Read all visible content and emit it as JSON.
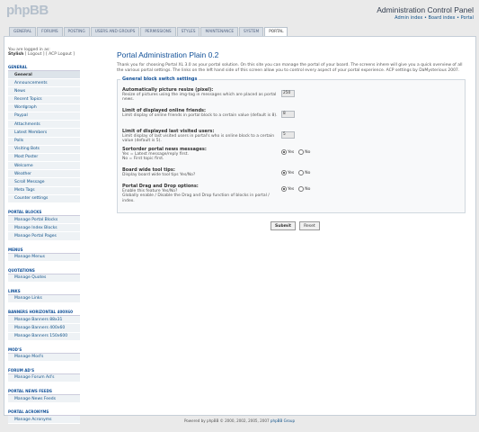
{
  "header": {
    "logo_text": "phpBB",
    "panel_title": "Administration Control Panel",
    "links": [
      "Admin index",
      "Board index",
      "Portal"
    ],
    "link_separator": "•"
  },
  "tabs": [
    "GENERAL",
    "FORUMS",
    "POSTING",
    "USERS AND GROUPS",
    "PERMISSIONS",
    "STYLES",
    "MAINTENANCE",
    "SYSTEM",
    "PORTAL"
  ],
  "active_tab": "PORTAL",
  "login": {
    "text": "You are logged in as:",
    "user": "Stylish",
    "logout": "[ Logout ]",
    "acp_logout": "[ ACP Logout ]"
  },
  "sidebar": [
    {
      "head": "General",
      "items": [
        "General",
        "Announcements",
        "News",
        "Recent Topics",
        "Wordgraph",
        "Paypal",
        "Attachments",
        "Latest Members",
        "Polls",
        "Visiting Bots",
        "Most Poster",
        "Welcome",
        "Weather",
        "Scroll Message",
        "Meta Tags",
        "Counter settings"
      ]
    },
    {
      "head": "Portal Blocks",
      "items": [
        "Manage Portal Blocks",
        "Manage Index Blocks",
        "Manage Portal Pages"
      ]
    },
    {
      "head": "Menus",
      "items": [
        "Manage Menus"
      ]
    },
    {
      "head": "Quotations",
      "items": [
        "Manage Quotes"
      ]
    },
    {
      "head": "Links",
      "items": [
        "Manage Links"
      ]
    },
    {
      "head": "Banners Horizontal 400x60",
      "items": [
        "Manage Banners 88x31",
        "Manage Banners 400x60",
        "Manage Banners 150x600"
      ]
    },
    {
      "head": "Mod's",
      "items": [
        "Manage Mod's"
      ]
    },
    {
      "head": "Forum Ad's",
      "items": [
        "Manage Forum Ad's"
      ]
    },
    {
      "head": "Portal News Feeds",
      "items": [
        "Manage News Feeds"
      ]
    },
    {
      "head": "Portal Acronyms",
      "items": [
        "Manage Acronyms"
      ]
    }
  ],
  "main": {
    "title": "Portal Administration Plain 0.2",
    "intro": "Thank you for choosing Portal XL 3.0 as your portal solution. On this site you can manage the portal of your board. The screens inhere will give you a quick overview of all the various portal settings. The links on the left hand side of this screen allow you to control every aspect of your portal experience. ACP settings by DaMysterious 2007.",
    "legend": "General block switch settings",
    "options": [
      {
        "label": "Automatically picture resize (pixel):",
        "desc": "Resize of pictures using the img-tag in messages which are placed as portal news.",
        "type": "number",
        "value": "250"
      },
      {
        "label": "Limit of displayed online friends:",
        "desc": "Limit display of online friends in portal block to a certain value (default is 8).",
        "type": "number",
        "value": "8"
      },
      {
        "label": "Limit of displayed last visited users:",
        "desc": "Limit display of last visited users in portal's who is online block to a certain value (default is 5).",
        "type": "number",
        "value": "5"
      },
      {
        "label": "Sortorder portal news messages:",
        "desc": "Yes = Latest message/reply first.\nNo = First topic first.",
        "type": "radio",
        "selected": "Yes"
      },
      {
        "label": "Board wide tool tips:",
        "desc": "Display board wide tool tips Yes/No?",
        "type": "radio",
        "selected": "Yes"
      },
      {
        "label": "Portal Drag and Drop options:",
        "desc": "Enable this feature Yes/No?\nGlobally enable / Disable the Drag and Drop function of blocks in portal / index.",
        "type": "radio",
        "selected": "Yes"
      }
    ],
    "radio_labels": [
      "Yes",
      "No"
    ],
    "submit": "Submit",
    "reset": "Reset"
  },
  "footer": {
    "text": "Powered by phpBB © 2000, 2002, 2005, 2007",
    "link": "phpBB Group"
  }
}
